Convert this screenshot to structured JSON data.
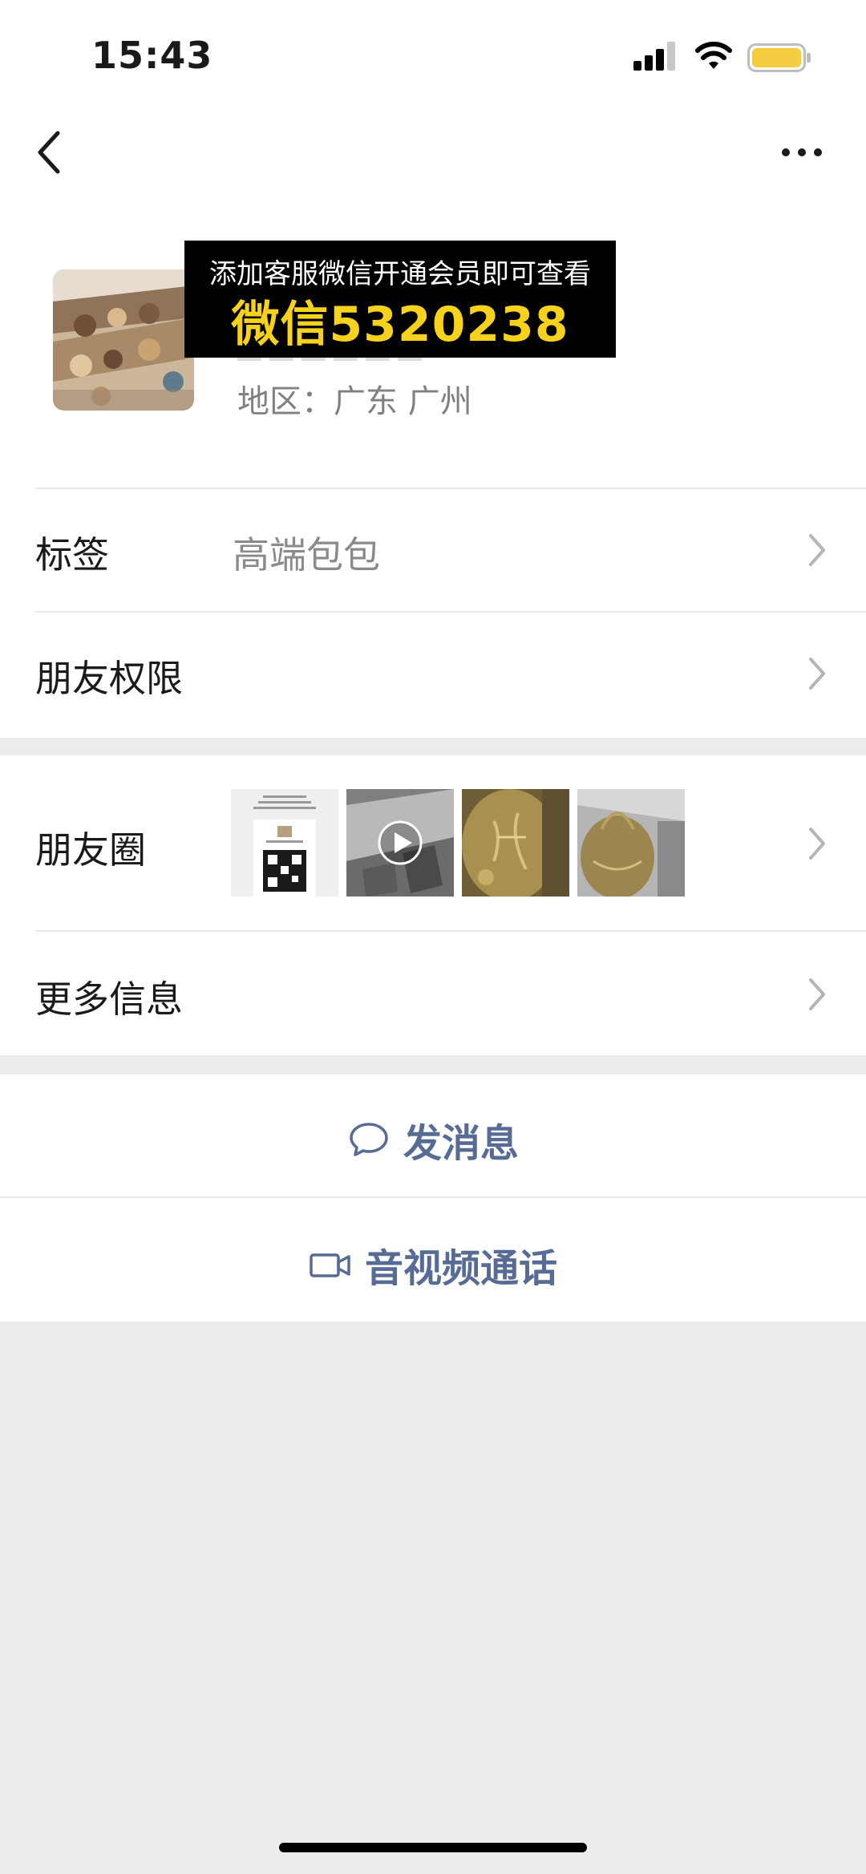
{
  "status_bar": {
    "time": "15:43"
  },
  "profile": {
    "region_label": "地区：",
    "region_value": "广东 广州"
  },
  "overlay": {
    "line1": "添加客服微信开通会员即可查看",
    "line2": "微信5320238"
  },
  "rows": {
    "tags": {
      "label": "标签",
      "value": "高端包包"
    },
    "permissions": {
      "label": "朋友权限"
    },
    "moments": {
      "label": "朋友圈"
    },
    "more_info": {
      "label": "更多信息"
    }
  },
  "actions": {
    "message": "发消息",
    "call": "音视频通话"
  },
  "colors": {
    "accent_link": "#576b95",
    "banner_highlight": "#f7d21c",
    "battery": "#f5cb42"
  },
  "icons": [
    "back-icon",
    "more-icon",
    "chevron-right-icon",
    "chat-bubble-icon",
    "video-camera-icon",
    "play-icon"
  ]
}
